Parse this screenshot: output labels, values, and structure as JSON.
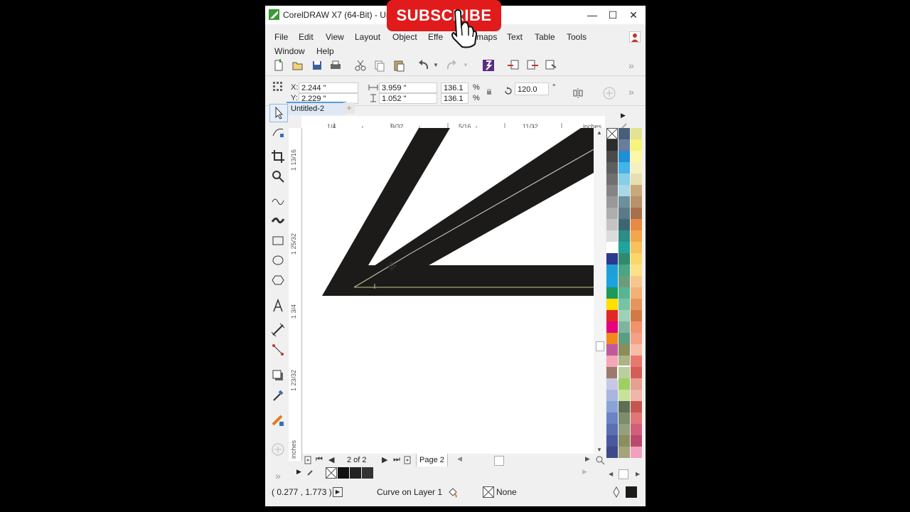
{
  "window": {
    "title": "CorelDRAW X7 (64-Bit) - Unt",
    "minimize": "—",
    "maximize": "☐",
    "close": "✕"
  },
  "overlay": {
    "subscribe_label": "SUBSCRIBE"
  },
  "menu": {
    "items": [
      "File",
      "Edit",
      "View",
      "Layout",
      "Object",
      "Effects",
      "Bitmaps",
      "Text",
      "Table",
      "Tools",
      "Window",
      "Help"
    ],
    "visible": {
      "file": "File",
      "edit": "Edit",
      "view": "View",
      "layout": "Layout",
      "object": "Object",
      "effects": "Effe",
      "bitmaps": "maps",
      "text": "Text",
      "table": "Table",
      "tools": "Tools",
      "window": "Window",
      "help": "Help"
    }
  },
  "property_bar": {
    "x_label": "X:",
    "y_label": "Y:",
    "x_value": "2.244 \"",
    "y_value": "2.229 \"",
    "width_value": "3.959 \"",
    "height_value": "1.052 \"",
    "scale_x": "136.1",
    "scale_y": "136.1",
    "percent": "%",
    "rotation": "120.0",
    "degree": "°"
  },
  "document": {
    "tab_label": "Untitled-2",
    "add_tab": "+"
  },
  "ruler": {
    "h_ticks": [
      "1/4",
      "9/32",
      "5/16",
      "11/32",
      "inches"
    ],
    "v_ticks": [
      "1 13/16",
      "1 25/32",
      "1 3/4",
      "1 23/32",
      "inches"
    ]
  },
  "page_nav": {
    "page_count": "2 of 2",
    "page_tab": "Page 2"
  },
  "status": {
    "coords": "( 0.277 , 1.773 )",
    "object_info": "Curve on Layer 1",
    "fill_none": "None"
  },
  "colors": {
    "background": "#000000",
    "window": "#f0f0f0",
    "canvas": "#ffffff",
    "subscribe_red": "#e11b1b",
    "shape_fill": "#1c1b19",
    "guide_line": "#c8c590"
  },
  "palette_colors": [
    [
      "#ffffff",
      "#2c2c2c",
      "#4a4a4a",
      "#5e5e5e",
      "#707070",
      "#858585",
      "#999999",
      "#aeaeae",
      "#c4c4c4",
      "#dcdcdc",
      "#ffffff",
      "#2b3a8f",
      "#1f9fd8",
      "#1aa3df",
      "#1b9a5c",
      "#ffe000",
      "#e32726",
      "#e6007e",
      "#f08a1d",
      "#be5a9c",
      "#f4a7b6",
      "#9b7a6b",
      "#c8c8e6",
      "#a7b7e0",
      "#8aa3d6",
      "#6b84c6",
      "#5c6fb2",
      "#49599e",
      "#3d4a8a"
    ],
    [
      "#4a5e7a",
      "#6a7d9a",
      "#1f8fd6",
      "#44b3e8",
      "#86cfe8",
      "#a8d8e6",
      "#6e8f9e",
      "#5a7a88",
      "#3c6670",
      "#2d8c87",
      "#1fa39b",
      "#2f8a6e",
      "#48a682",
      "#6d9c7b",
      "#58b594",
      "#76c4a4",
      "#9ed1b8",
      "#7fb59d",
      "#5c9e83",
      "#8d8c5b",
      "#a9b585",
      "#b8cf9e",
      "#9fcf62",
      "#c7e39a",
      "#5d6e55",
      "#7d8c6a",
      "#92a07d",
      "#8a8f5f",
      "#a6a27c"
    ],
    [
      "#e3e392",
      "#f7f47a",
      "#fdf8a6",
      "#f5f0c2",
      "#e8dfb0",
      "#c9a97a",
      "#b8926a",
      "#a86f4c",
      "#e88a43",
      "#f3a64a",
      "#f8c15a",
      "#fbd76a",
      "#fde189",
      "#f7c68f",
      "#f4b177",
      "#e6955b",
      "#d27a46",
      "#f2926b",
      "#f4a186",
      "#f7bda8",
      "#e8786c",
      "#d35e57",
      "#e6a08f",
      "#f0b6a8",
      "#c4564f",
      "#e07676",
      "#d35e7a",
      "#b94a6e",
      "#f2a0c0"
    ]
  ]
}
